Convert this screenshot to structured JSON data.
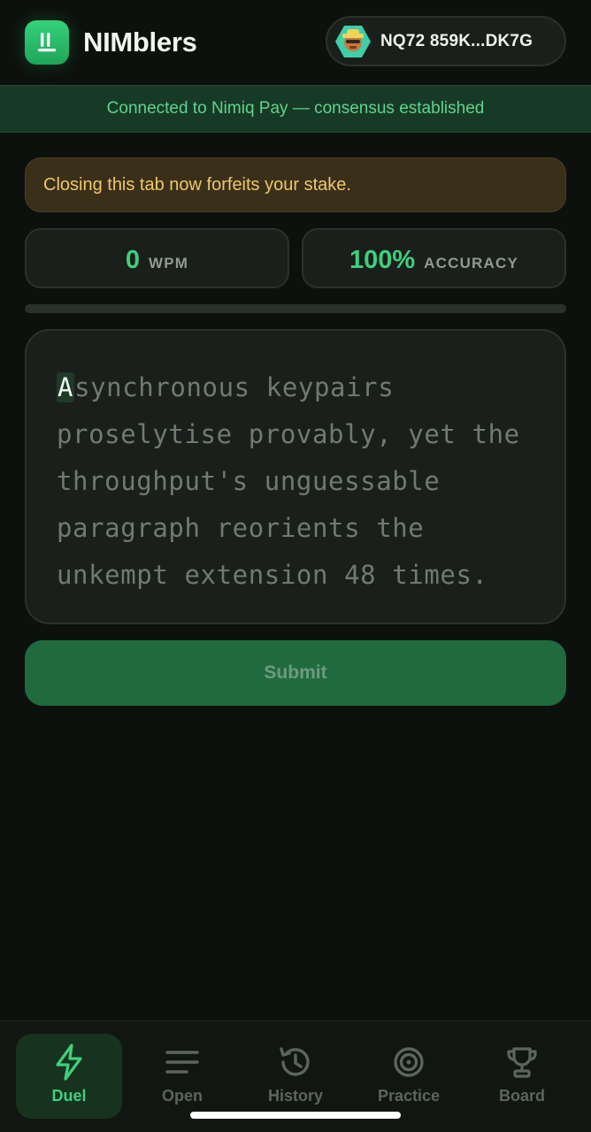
{
  "header": {
    "brand": "NIMblers",
    "wallet_address": "NQ72 859K...DK7G"
  },
  "connection": {
    "text": "Connected to Nimiq Pay — consensus established"
  },
  "warning": {
    "text": "Closing this tab now forfeits your stake."
  },
  "stats": {
    "wpm_value": "0",
    "wpm_unit": "WPM",
    "accuracy_value": "100%",
    "accuracy_unit": "ACCURACY"
  },
  "progress": {
    "fraction": 0
  },
  "typing": {
    "current_char": "A",
    "remaining_text": "synchronous keypairs proselytise provably, yet the throughput's unguessable paragraph reorients the unkempt extension 48 times."
  },
  "submit_label": "Submit",
  "nav": {
    "items": [
      {
        "label": "Duel",
        "icon": "lightning-icon",
        "active": true
      },
      {
        "label": "Open",
        "icon": "list-lines-icon",
        "active": false
      },
      {
        "label": "History",
        "icon": "history-clock-icon",
        "active": false
      },
      {
        "label": "Practice",
        "icon": "target-icon",
        "active": false
      },
      {
        "label": "Board",
        "icon": "trophy-icon",
        "active": false
      }
    ]
  },
  "colors": {
    "accent": "#3fcf7c",
    "warning": "#f0c768",
    "background": "#0d110e"
  }
}
